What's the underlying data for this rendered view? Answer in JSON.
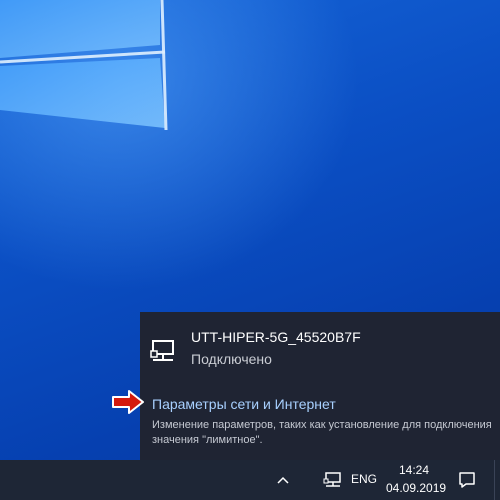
{
  "desktop": {
    "wallpaper_icon": "windows-logo-panes"
  },
  "flyout": {
    "network": {
      "icon": "ethernet-network-icon",
      "name": "UTT-HIPER-5G_45520B7F",
      "status": "Подключено"
    },
    "settings_link": "Параметры сети и Интернет",
    "settings_description": "Изменение параметров, таких как установление для подключения значения \"лимитное\".",
    "pointer_icon": "red-arrow-icon"
  },
  "taskbar": {
    "tray_chevron_icon": "chevron-up-icon",
    "network_icon": "network-icon",
    "language": "ENG",
    "time": "14:24",
    "date": "04.09.2019",
    "notification_icon": "action-center-icon"
  },
  "colors": {
    "flyout_bg": "#1f2433",
    "taskbar_bg": "#1e2636",
    "link": "#a8d0ff",
    "arrow": "#d41a0e"
  }
}
